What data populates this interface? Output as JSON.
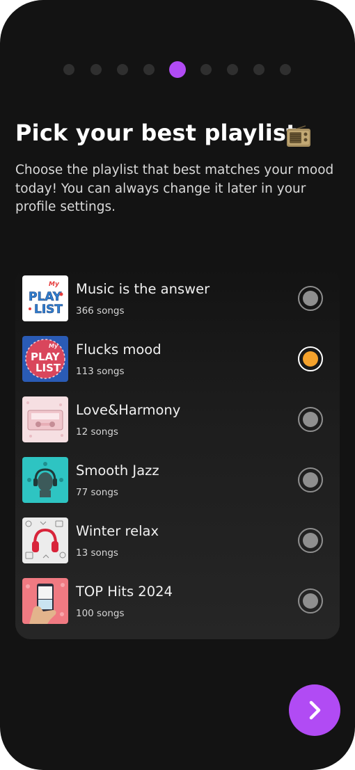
{
  "progress": {
    "total_steps": 9,
    "current_step": 5
  },
  "header": {
    "title": "Pick your best playlist",
    "title_icon": "radio-icon",
    "subtitle": "Choose the playlist that best matches your mood today! You can always change it later in your profile settings."
  },
  "playlists": [
    {
      "name": "Music is the answer",
      "count": "366 songs",
      "cover": "my-playlist-sticker-cover",
      "selected": false
    },
    {
      "name": "Flucks mood",
      "count": "113 songs",
      "cover": "my-playlist-badge-cover",
      "selected": true
    },
    {
      "name": "Love&Harmony",
      "count": "12 songs",
      "cover": "cassette-tape-cover",
      "selected": false
    },
    {
      "name": "Smooth Jazz",
      "count": "77 songs",
      "cover": "headphones-face-cover",
      "selected": false
    },
    {
      "name": "Winter relax",
      "count": "13 songs",
      "cover": "red-headphones-pattern-cover",
      "selected": false
    },
    {
      "name": "TOP Hits 2024",
      "count": "100 songs",
      "cover": "phone-in-hand-cover",
      "selected": false
    }
  ],
  "next_button": {
    "icon": "chevron-right-icon"
  },
  "colors": {
    "background": "#131313",
    "accent": "#b14bf4",
    "selected_radio": "#f5a22c",
    "inactive_dot": "#2f2f2f",
    "radio_unselected": "#8f8f8f"
  }
}
